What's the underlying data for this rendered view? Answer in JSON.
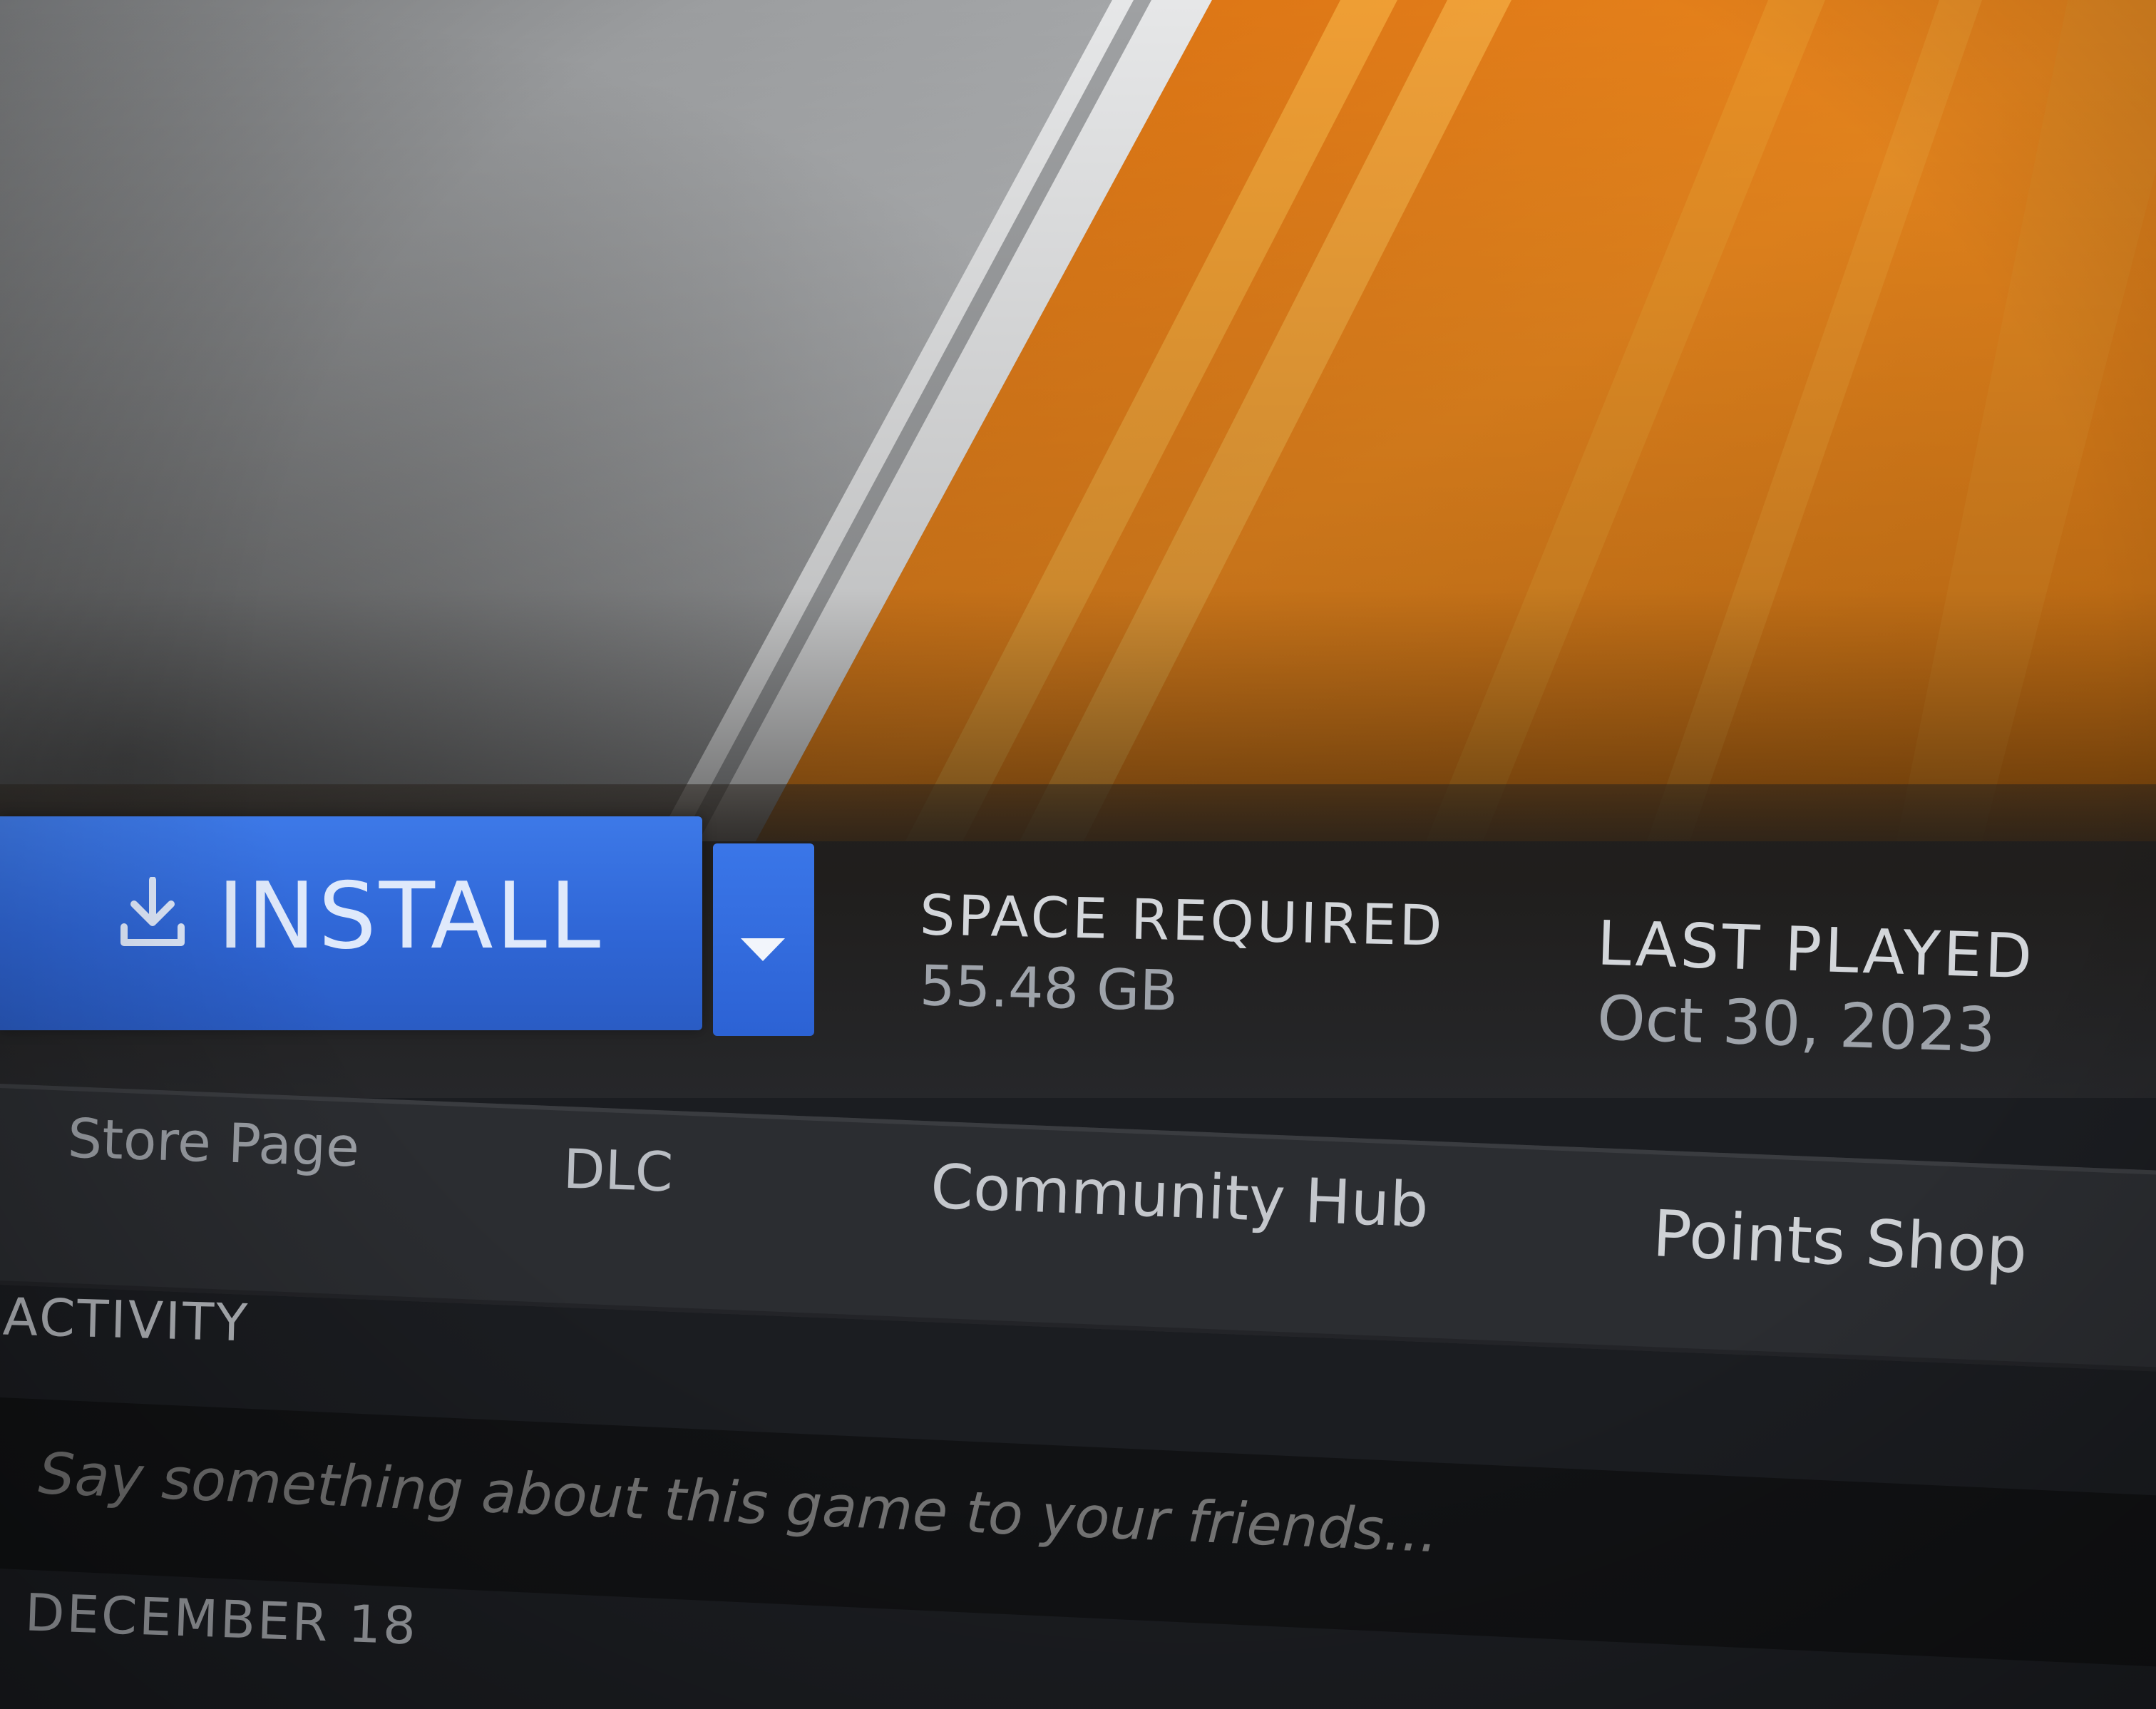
{
  "colors": {
    "accent_blue": "#2f66d6",
    "banner_orange": "#e8821c",
    "banner_grey": "#a9abad",
    "background_dark": "#1b1d21"
  },
  "hero": {
    "image_icon": "game-hero-art"
  },
  "action_bar": {
    "install_label": "INSTALL",
    "install_icon": "download-icon",
    "dropdown_icon": "chevron-down-icon",
    "space_required_label": "SPACE REQUIRED",
    "space_required_value": "55.48 GB",
    "last_played_label": "LAST PLAYED",
    "last_played_value": "Oct 30, 2023"
  },
  "tabs": [
    {
      "label": "Store Page"
    },
    {
      "label": "DLC"
    },
    {
      "label": "Community Hub"
    },
    {
      "label": "Points Shop"
    }
  ],
  "activity": {
    "heading": "ACTIVITY",
    "input_placeholder": "Say something about this game to your friends...",
    "date_heading": "DECEMBER 18"
  }
}
